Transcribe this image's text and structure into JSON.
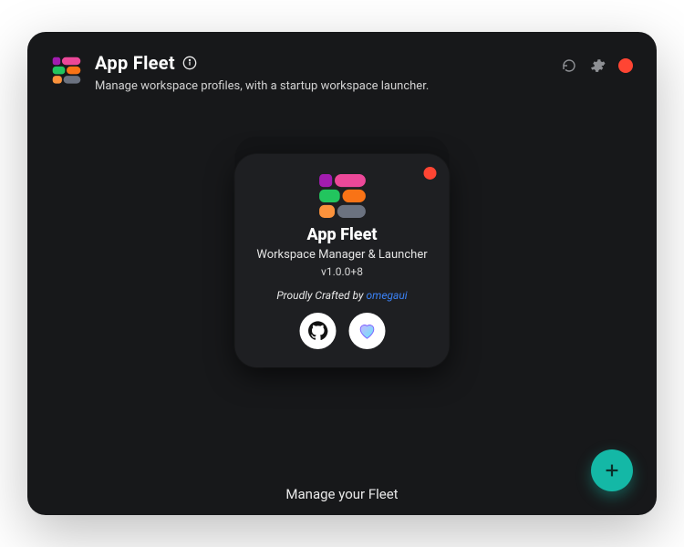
{
  "header": {
    "title": "App Fleet",
    "subtitle": "Manage workspace profiles, with a startup workspace launcher."
  },
  "about": {
    "title": "App Fleet",
    "subtitle": "Workspace Manager & Launcher",
    "version": "v1.0.0+8",
    "credit_prefix": "Proudly Crafted by ",
    "author": "omegaui"
  },
  "footer": {
    "text": "Manage your Fleet"
  },
  "icons": {
    "info": "info-icon",
    "reload": "reload-icon",
    "settings": "gear-icon",
    "close": "close-dot",
    "github": "github-icon",
    "sponsor": "heart-icon",
    "add": "plus-icon"
  },
  "colors": {
    "add_button": "#14b8a6",
    "close_dot": "#ff4533",
    "author_link": "#3b82f6"
  }
}
